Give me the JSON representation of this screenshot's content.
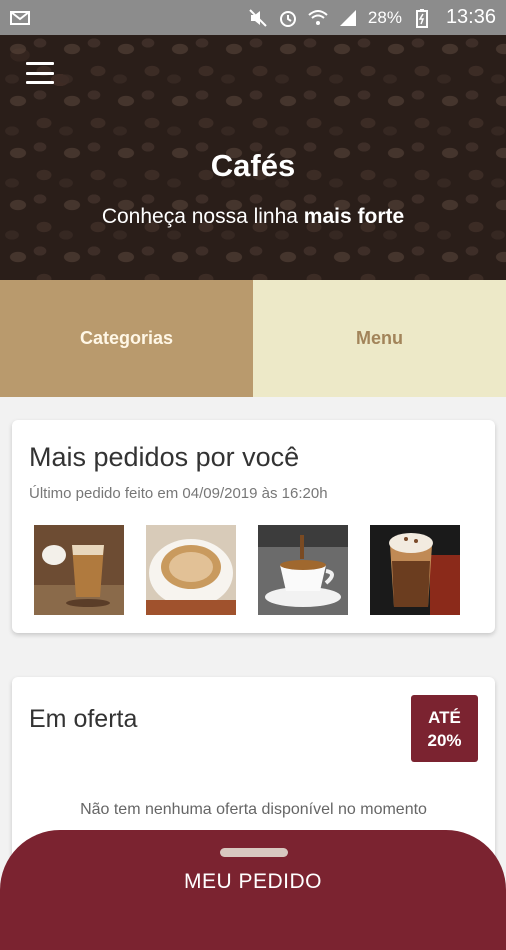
{
  "statusbar": {
    "battery": "28%",
    "clock": "13:36",
    "icons": [
      "mail-icon",
      "mute-icon",
      "alarm-icon",
      "wifi-icon",
      "signal-icon",
      "battery-icon"
    ]
  },
  "hero": {
    "title": "Cafés",
    "subtitle_regular": "Conheça nossa linha ",
    "subtitle_bold": "mais forte"
  },
  "tabs": {
    "categorias": "Categorias",
    "menu": "Menu"
  },
  "recent": {
    "title": "Mais pedidos por você",
    "subtitle": "Último pedido feito em 04/09/2019 às 16:20h",
    "items": [
      "coffee-product-1",
      "coffee-product-2",
      "coffee-product-3",
      "coffee-product-4"
    ]
  },
  "offers": {
    "title": "Em oferta",
    "badge_line1": "ATÉ",
    "badge_line2": "20%",
    "empty_message": "Não tem nenhuma oferta disponível no momento"
  },
  "order": {
    "label": "MEU PEDIDO"
  },
  "colors": {
    "accent": "#7b2330",
    "tab_categorias": "#b99a6d",
    "tab_menu": "#ede9c8"
  }
}
